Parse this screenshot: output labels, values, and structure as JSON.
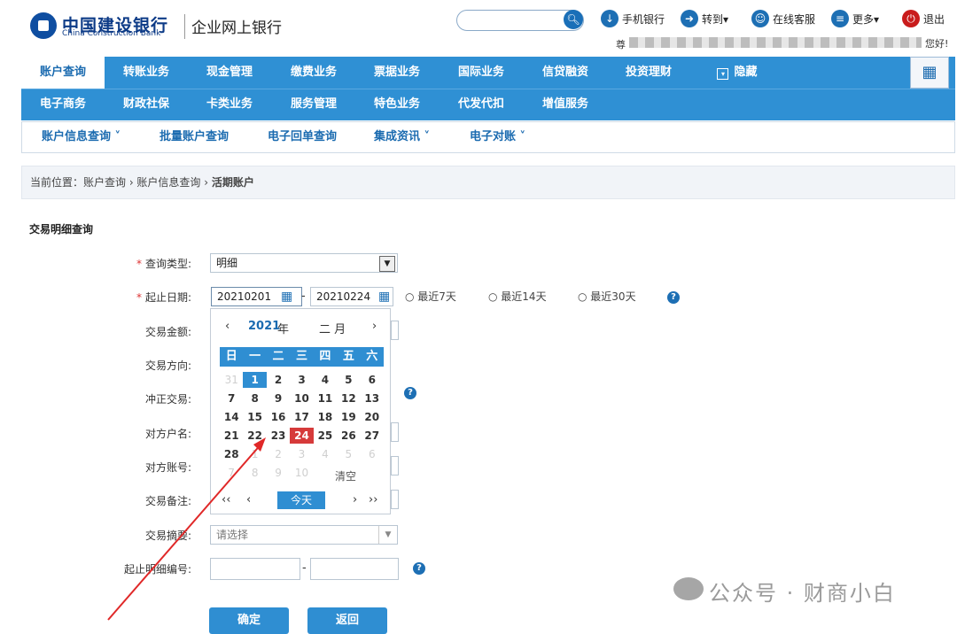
{
  "header": {
    "bank_name_cn": "中国建设银行",
    "bank_name_en": "China Construction Bank",
    "product": "企业网上银行",
    "search_placeholder": "",
    "tools": [
      {
        "label": "手机银行",
        "icon": "mobile-icon"
      },
      {
        "label": "转到▾",
        "icon": "goto-icon"
      },
      {
        "label": "在线客服",
        "icon": "service-icon"
      },
      {
        "label": "更多▾",
        "icon": "more-icon"
      },
      {
        "label": "退出",
        "icon": "power-icon"
      }
    ],
    "greeting_prefix": "尊",
    "greeting": "您好!"
  },
  "nav": {
    "row1": [
      "账户查询",
      "转账业务",
      "现金管理",
      "缴费业务",
      "票据业务",
      "国际业务",
      "信贷融资",
      "投资理财",
      "隐藏"
    ],
    "row2": [
      "电子商务",
      "财政社保",
      "卡类业务",
      "服务管理",
      "特色业务",
      "代发代扣",
      "增值服务"
    ]
  },
  "subnav": [
    "账户信息查询 ˅",
    "批量账户查询",
    "电子回单查询",
    "集成资讯 ˅",
    "电子对账 ˅"
  ],
  "breadcrumb": {
    "prefix": "当前位置：账户查询 › 账户信息查询 › ",
    "current": "活期账户"
  },
  "form": {
    "title": "交易明细查询",
    "query_type_label": "查询类型:",
    "query_type_value": "明细",
    "date_label": "起止日期:",
    "date_start": "20210201",
    "date_end": "20210224",
    "dash": "-",
    "radios": [
      "最近7天",
      "最近14天",
      "最近30天"
    ],
    "labels": [
      "交易金额:",
      "交易方向:",
      "冲正交易:",
      "对方户名:",
      "对方账号:",
      "交易备注:",
      "交易摘要:",
      "起止明细编号:"
    ],
    "summary_placeholder": "请选择",
    "buttons": {
      "confirm": "确定",
      "back": "返回"
    }
  },
  "calendar": {
    "year": "2021",
    "year_suffix": "年",
    "month": "二 月",
    "weekdays": [
      "日",
      "一",
      "二",
      "三",
      "四",
      "五",
      "六"
    ],
    "days": [
      "31",
      "1",
      "2",
      "3",
      "4",
      "5",
      "6",
      "7",
      "8",
      "9",
      "10",
      "11",
      "12",
      "13",
      "14",
      "15",
      "16",
      "17",
      "18",
      "19",
      "20",
      "21",
      "22",
      "23",
      "24",
      "25",
      "26",
      "27",
      "28",
      "1",
      "2",
      "3",
      "4",
      "5",
      "6",
      "7",
      "8",
      "9",
      "10"
    ],
    "clear": "清空",
    "today": "今天",
    "selected_day": "1",
    "today_day": "24"
  },
  "watermark": "公众号 · 财商小白",
  "colors": {
    "nav": "#2f90d4",
    "today": "#d63a3a",
    "annotation": "#e02828"
  }
}
